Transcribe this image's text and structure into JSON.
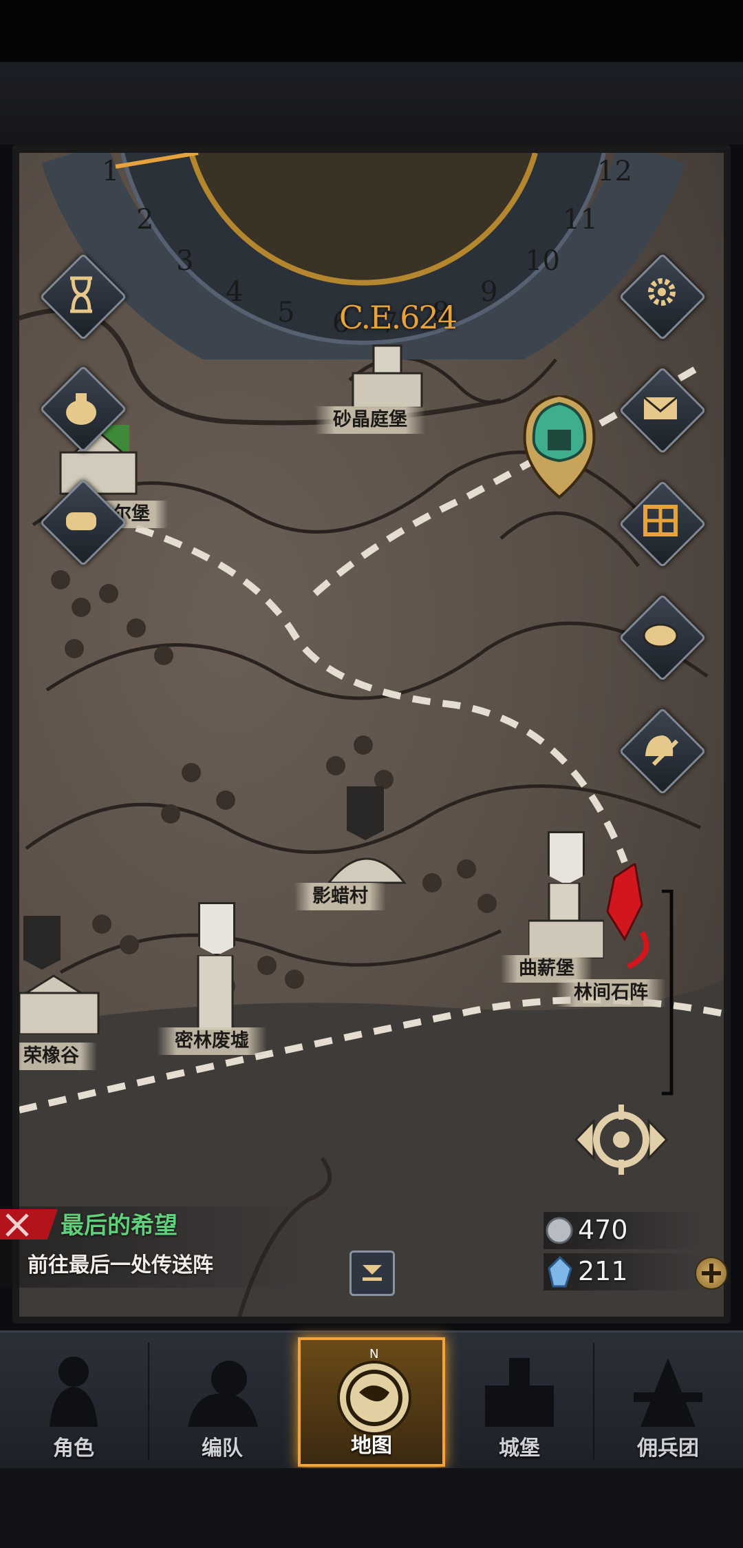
{
  "calendar": {
    "year": "C.E.624",
    "months": [
      "1",
      "2",
      "3",
      "4",
      "5",
      "6",
      "7",
      "8",
      "9",
      "10",
      "11",
      "12"
    ]
  },
  "locations": {
    "shajing": "砂晶庭堡",
    "erbao": "尔堡",
    "yingla": "影蜡村",
    "quxin": "曲薪堡",
    "linjian": "林间石阵",
    "milin": "密林废墟",
    "rongxiang": "荣橡谷"
  },
  "left_buttons": [
    "hourglass-icon",
    "money-bag-icon",
    "scroll-icon"
  ],
  "right_buttons": [
    "gear-icon",
    "mail-icon",
    "shop-icon",
    "coin-icon",
    "helmet-sword-icon"
  ],
  "quest": {
    "title": "最后的希望",
    "description": "前往最后一处传送阵"
  },
  "resources": {
    "silver": "470",
    "crystal": "211"
  },
  "nav": {
    "character": "角色",
    "team": "编队",
    "map": "地图",
    "castle": "城堡",
    "mercenary": "佣兵团"
  },
  "compass_letter": "N",
  "colors": {
    "year_gold": "#e6a23c",
    "quest_green": "#5fd17a",
    "nav_active": "#f2a43a",
    "marker_red": "#d2161e"
  }
}
